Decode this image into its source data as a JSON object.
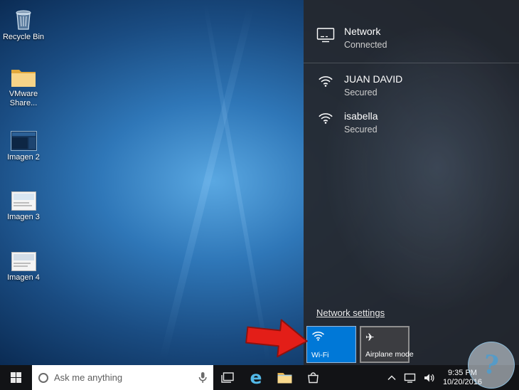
{
  "desktop": {
    "icons": [
      {
        "label": "Recycle Bin"
      },
      {
        "label": "VMware Share..."
      },
      {
        "label": "Imagen 2"
      },
      {
        "label": "Imagen 3"
      },
      {
        "label": "Imagen 4"
      }
    ]
  },
  "flyout": {
    "network": {
      "name": "Network",
      "status": "Connected"
    },
    "wifi_list": [
      {
        "name": "JUAN DAVID",
        "status": "Secured"
      },
      {
        "name": "isabella",
        "status": "Secured"
      }
    ],
    "settings_link": "Network settings",
    "wifi_tile": "Wi-Fi",
    "airplane_tile": "Airplane mode"
  },
  "taskbar": {
    "search_placeholder": "Ask me anything",
    "time": "9:35 PM",
    "date": "10/20/2016"
  },
  "icons": {
    "ethernet": "monitor-with-cable",
    "wifi": "signal-arcs",
    "airplane": "✈",
    "start": "windows-logo",
    "cortana": "ring",
    "microphone": "mic",
    "task_view": "overlapping-rects",
    "edge": "e",
    "file_explorer": "folder",
    "store": "shopping-bag",
    "tray_expand": "chevron-up",
    "network_tray": "monitor",
    "volume": "speaker"
  },
  "colors": {
    "accent": "#0078d7",
    "arrow_red": "#e31e18",
    "flyout_bg": "#25272c",
    "taskbar_bg": "#121316"
  }
}
